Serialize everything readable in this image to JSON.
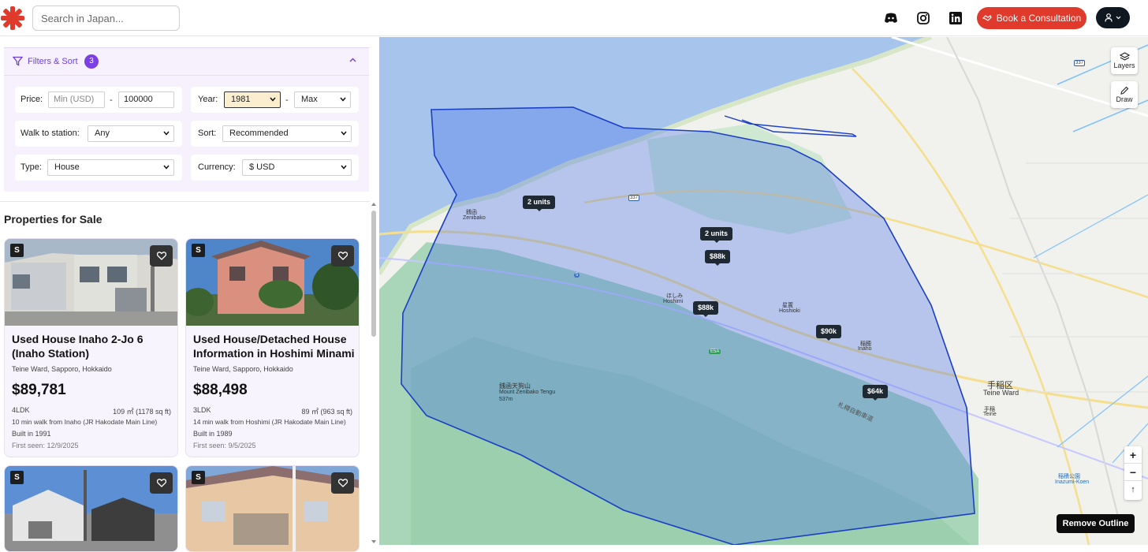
{
  "header": {
    "search_placeholder": "Search in Japan...",
    "icons": [
      "discord-icon",
      "instagram-icon",
      "linkedin-icon"
    ],
    "book_label": "Book a Consultation",
    "accent": "#e03a2d"
  },
  "filters": {
    "title": "Filters & Sort",
    "count": "3",
    "price_label": "Price:",
    "price_min_placeholder": "Min (USD)",
    "price_max": "100000",
    "year_label": "Year:",
    "year_min": "1981",
    "year_max": "Max",
    "walk_label": "Walk to station:",
    "walk_value": "Any",
    "sort_label": "Sort:",
    "sort_value": "Recommended",
    "type_label": "Type:",
    "type_value": "House",
    "currency_label": "Currency:",
    "currency_value": "$ USD"
  },
  "listings": {
    "title": "Properties for Sale",
    "cards": [
      {
        "badge": "S",
        "name": "Used House Inaho 2-Jo 6",
        "name_line2": "(Inaho Station)",
        "location": "Teine Ward, Sapporo, Hokkaido",
        "price": "$89,781",
        "layout": "4LDK",
        "size": "109 ㎡ (1178 sq ft)",
        "walk": "10 min walk from Inaho (JR Hakodate Main Line)",
        "built": "Built in 1991",
        "seen": "First seen: 12/9/2025"
      },
      {
        "badge": "S",
        "name": "Used House/Detached House",
        "name_line2": "Information in Hoshimi Minami",
        "location": "Teine Ward, Sapporo, Hokkaido",
        "price": "$88,498",
        "layout": "3LDK",
        "size": "89 ㎡ (963 sq ft)",
        "walk": "14 min walk from Hoshimi (JR Hakodate Main Line)",
        "built": "Built in 1989",
        "seen": "First seen: 9/5/2025"
      },
      {
        "badge": "S"
      },
      {
        "badge": "S"
      }
    ]
  },
  "map": {
    "layers_label": "Layers",
    "draw_label": "Draw",
    "zoom_in": "+",
    "zoom_out": "−",
    "reset_north": "↑",
    "remove_outline": "Remove Outline",
    "markers": [
      "2 units",
      "2 units",
      "$88k",
      "$88k",
      "$90k",
      "$64k"
    ],
    "labels": {
      "zenibako_jp": "銭函",
      "zenibako": "Zenibako",
      "hoshimi_jp": "ほしみ",
      "hoshimi": "Hoshimi",
      "hoshioki_jp": "星置",
      "hoshioki": "Hoshioki",
      "inaho_jp": "稲穂",
      "inaho": "Inaho",
      "mountain_jp": "銭函天狗山",
      "mountain": "Mount Zenibako Tengu",
      "mountain_elev": "537m",
      "teine_jp": "手稲区",
      "teine_ward": "Teine Ward",
      "teine_st_jp": "手稲",
      "teine_st": "Teine",
      "inazumi_jp": "稲積公園",
      "inazumi": "Inazumi-Koen",
      "expressway": "札樽自動車道",
      "route_337a": "337",
      "route_337b": "337",
      "route_5": "5",
      "esa": "E5A"
    },
    "polygon_color": "#1a3fc4",
    "water_color": "#a9c7ef"
  }
}
